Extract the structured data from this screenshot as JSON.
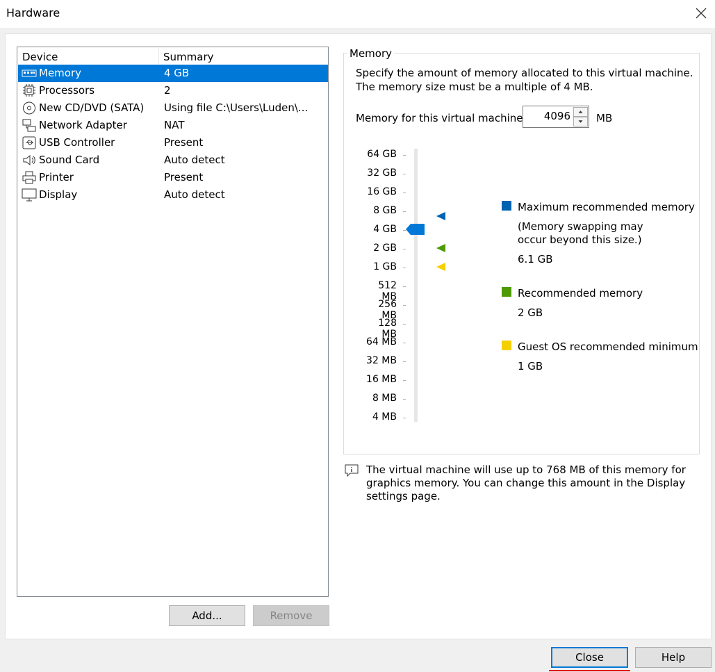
{
  "window": {
    "title": "Hardware"
  },
  "device_list": {
    "headers": {
      "device": "Device",
      "summary": "Summary"
    },
    "rows": [
      {
        "name": "Memory",
        "summary": "4 GB",
        "icon": "memory-icon",
        "selected": true
      },
      {
        "name": "Processors",
        "summary": "2",
        "icon": "processor-icon"
      },
      {
        "name": "New CD/DVD (SATA)",
        "summary": "Using file C:\\Users\\Luden\\...",
        "icon": "cd-icon"
      },
      {
        "name": "Network Adapter",
        "summary": "NAT",
        "icon": "network-icon"
      },
      {
        "name": "USB Controller",
        "summary": "Present",
        "icon": "usb-icon"
      },
      {
        "name": "Sound Card",
        "summary": "Auto detect",
        "icon": "speaker-icon"
      },
      {
        "name": "Printer",
        "summary": "Present",
        "icon": "printer-icon"
      },
      {
        "name": "Display",
        "summary": "Auto detect",
        "icon": "monitor-icon"
      }
    ],
    "add_label": "Add...",
    "remove_label": "Remove"
  },
  "memory": {
    "group_title": "Memory",
    "description_line1": "Specify the amount of memory allocated to this virtual machine.",
    "description_line2": "The memory size must be a multiple of 4 MB.",
    "field_label": "Memory for this virtual machine:",
    "value": "4096",
    "unit": "MB",
    "scale": [
      "64 GB",
      "32 GB",
      "16 GB",
      "8 GB",
      "4 GB",
      "2 GB",
      "1 GB",
      "512 MB",
      "256 MB",
      "128 MB",
      "64 MB",
      "32 MB",
      "16 MB",
      "8 MB",
      "4 MB"
    ],
    "legend": {
      "max_label": "Maximum recommended memory",
      "max_note_line1": "(Memory swapping may",
      "max_note_line2": "occur beyond this size.)",
      "max_value": "6.1 GB",
      "rec_label": "Recommended memory",
      "rec_value": "2 GB",
      "min_label": "Guest OS recommended minimum",
      "min_value": "1 GB"
    },
    "colors": {
      "max": "#0063b1",
      "rec": "#4e9a06",
      "min": "#f5d000",
      "slider": "#0078d7"
    }
  },
  "info": {
    "line1": "The virtual machine will use up to 768 MB of this memory for",
    "line2": "graphics memory. You can change this amount in the Display",
    "line3": "settings page."
  },
  "footer": {
    "close_label": "Close",
    "help_label": "Help"
  }
}
